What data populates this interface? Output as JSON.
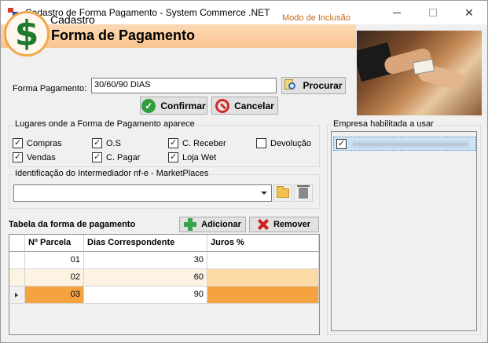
{
  "window": {
    "title": "Cadastro de Forma Pagamento  -  System Commerce .NET",
    "min_glyph": "",
    "close_glyph": "✕"
  },
  "header": {
    "small_title": "Cadastro",
    "big_title": "Forma de Pagamento",
    "mode": "Modo de Inclusão",
    "logo_symbol": "$"
  },
  "form": {
    "forma_label": "Forma Pagamento:",
    "forma_value": "30/60/90 DIAS",
    "procurar_label": "Procurar",
    "confirmar_label": "Confirmar",
    "cancelar_label": "Cancelar"
  },
  "lugares": {
    "title": "Lugares onde a Forma de Pagamento aparece",
    "options": [
      {
        "label": "Compras",
        "checked": true
      },
      {
        "label": "O.S",
        "checked": true
      },
      {
        "label": "C. Receber",
        "checked": true
      },
      {
        "label": "Devolução",
        "checked": false
      },
      {
        "label": "Vendas",
        "checked": true
      },
      {
        "label": "C. Pagar",
        "checked": true
      },
      {
        "label": "Loja Wet",
        "checked": true
      }
    ]
  },
  "intermediador": {
    "title": "Identificação do Intermediador nf-e - MarketPlaces",
    "value": ""
  },
  "tabela": {
    "title": "Tabela da forma de pagamento",
    "adicionar_label": "Adicionar",
    "remover_label": "Remover",
    "columns": [
      "Nº Parcela",
      "Dias Correspondente",
      "Juros %"
    ],
    "rows": [
      {
        "parcela": "01",
        "dias": "30",
        "juros": ""
      },
      {
        "parcela": "02",
        "dias": "60",
        "juros": ""
      },
      {
        "parcela": "03",
        "dias": "90",
        "juros": ""
      }
    ],
    "selected_row": 2
  },
  "empresa": {
    "title": "Empresa habilitada a usar",
    "items": [
      {
        "checked": true
      }
    ]
  },
  "colors": {
    "accent_orange": "#f4a340",
    "header_band": "#f9c590",
    "mode_text": "#c06a1e"
  },
  "icons": {
    "app": "app-icon",
    "logo": "dollar-logo-icon",
    "procurar": "search-icon",
    "confirmar": "check-icon",
    "cancelar": "cancel-icon",
    "folder": "folder-icon",
    "trash": "trash-icon",
    "adicionar": "plus-icon",
    "remover": "x-icon"
  }
}
